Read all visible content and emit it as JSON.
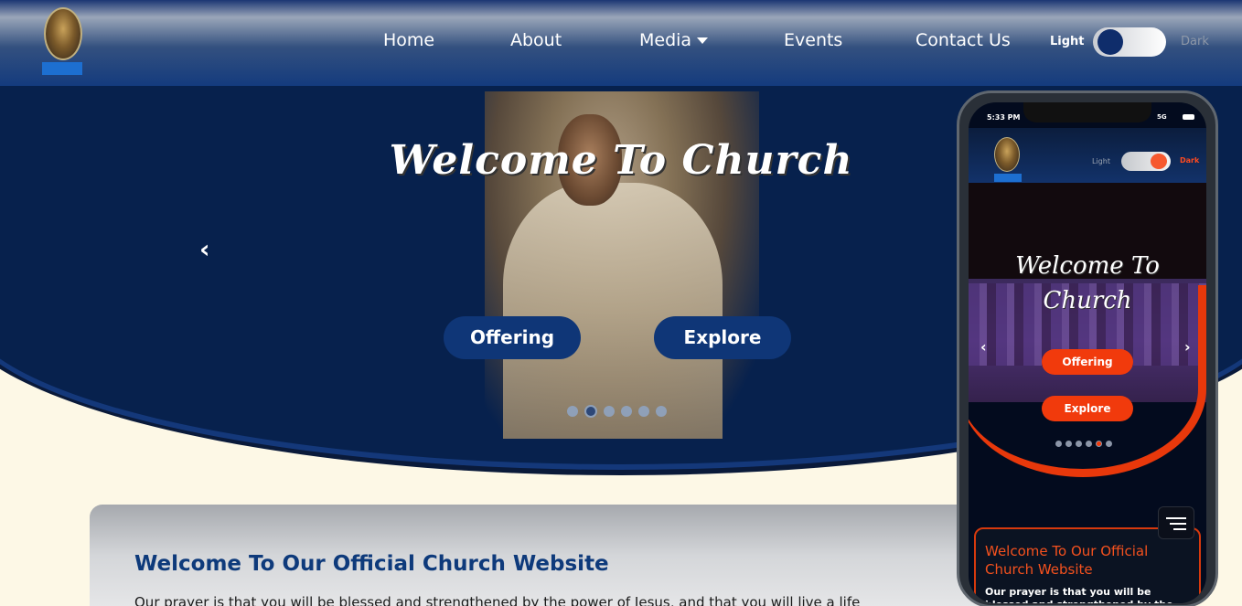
{
  "nav": {
    "items": [
      {
        "label": "Home"
      },
      {
        "label": "About"
      },
      {
        "label": "Media"
      },
      {
        "label": "Events"
      },
      {
        "label": "Contact Us"
      }
    ],
    "theme_light_label": "Light",
    "theme_dark_label": "Dark",
    "theme": "light"
  },
  "hero": {
    "title": "Welcome To Church",
    "prev_icon": "‹",
    "buttons": {
      "offering": "Offering",
      "explore": "Explore"
    },
    "dots_count": 6,
    "active_dot": 1
  },
  "welcome": {
    "title": "Welcome To Our Official Church Website",
    "text": "Our prayer is that you will be blessed and strengthened by the power of Jesus, and that you will live a life"
  },
  "phone": {
    "status_time": "5:33 PM",
    "status_signal": "5G",
    "theme_light_label": "Light",
    "theme_dark_label": "Dark",
    "theme": "dark",
    "hero_title": "Welcome To Church",
    "prev_icon": "‹",
    "next_icon": "›",
    "buttons": {
      "offering": "Offering",
      "explore": "Explore"
    },
    "dots_count": 6,
    "active_dot": 4,
    "card_title": "Welcome To Our Official Church Website",
    "card_text": "Our prayer is that you will be blessed and strengthened by the power of"
  },
  "colors": {
    "navy": "#07214d",
    "accent_blue": "#0f3677",
    "title_blue": "#0e3a7b",
    "cream": "#fdf8e6",
    "mobile_accent": "#f13a0c"
  },
  "icons": {
    "media_dropdown": "caret-down-icon",
    "hero_prev": "chevron-left-icon",
    "mobile_next": "chevron-right-icon",
    "mobile_menu": "hamburger-menu-icon"
  }
}
